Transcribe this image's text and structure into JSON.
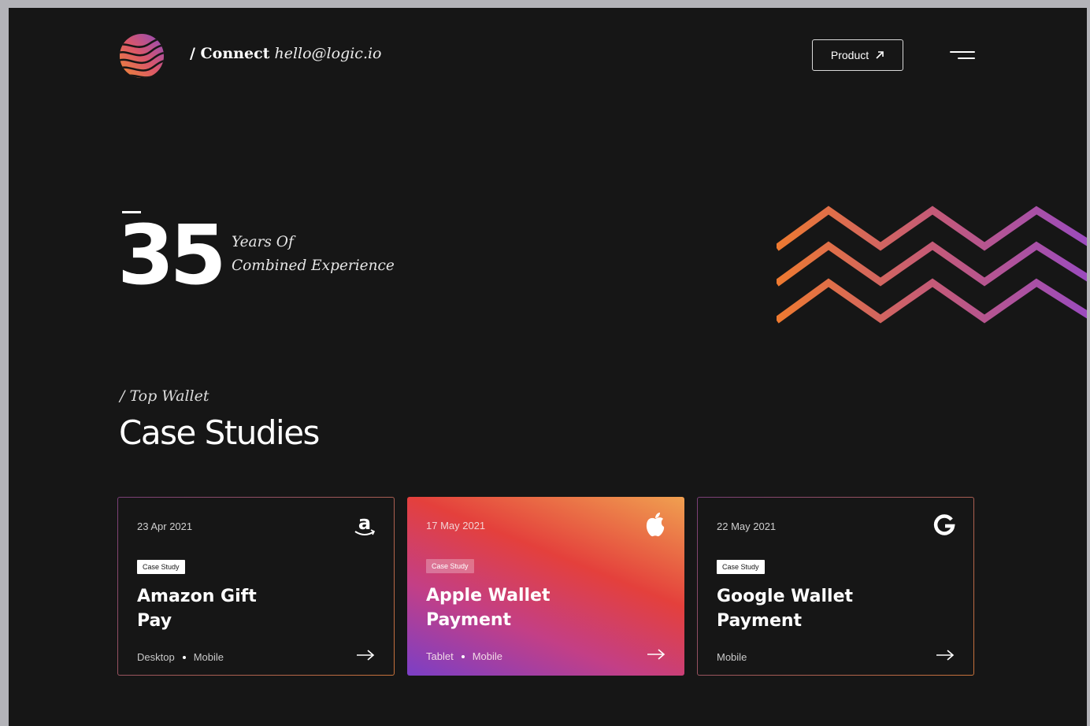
{
  "header": {
    "connect_label": "/ Connect",
    "email": "hello@logic.io",
    "product_button": "Product"
  },
  "hero": {
    "number": "35",
    "line1": "Years Of",
    "line2": "Combined Experience"
  },
  "section": {
    "eyebrow": "/ Top Wallet",
    "title": "Case Studies"
  },
  "cards": [
    {
      "date": "23 Apr 2021",
      "badge": "Case Study",
      "title_line1": "Amazon Gift",
      "title_line2": "Pay",
      "tag1": "Desktop",
      "tag2": "Mobile",
      "brand_icon": "amazon-icon"
    },
    {
      "date": "17 May 2021",
      "badge": "Case Study",
      "title_line1": "Apple Wallet",
      "title_line2": "Payment",
      "tag1": "Tablet",
      "tag2": "Mobile",
      "brand_icon": "apple-icon"
    },
    {
      "date": "22 May 2021",
      "badge": "Case Study",
      "title_line1": "Google Wallet",
      "title_line2": "Payment",
      "tag1": "Mobile",
      "brand_icon": "google-icon"
    }
  ],
  "colors": {
    "background": "#161616",
    "gradient_orange": "#e8763a",
    "gradient_purple": "#9a4bc0",
    "text": "#ffffff"
  }
}
